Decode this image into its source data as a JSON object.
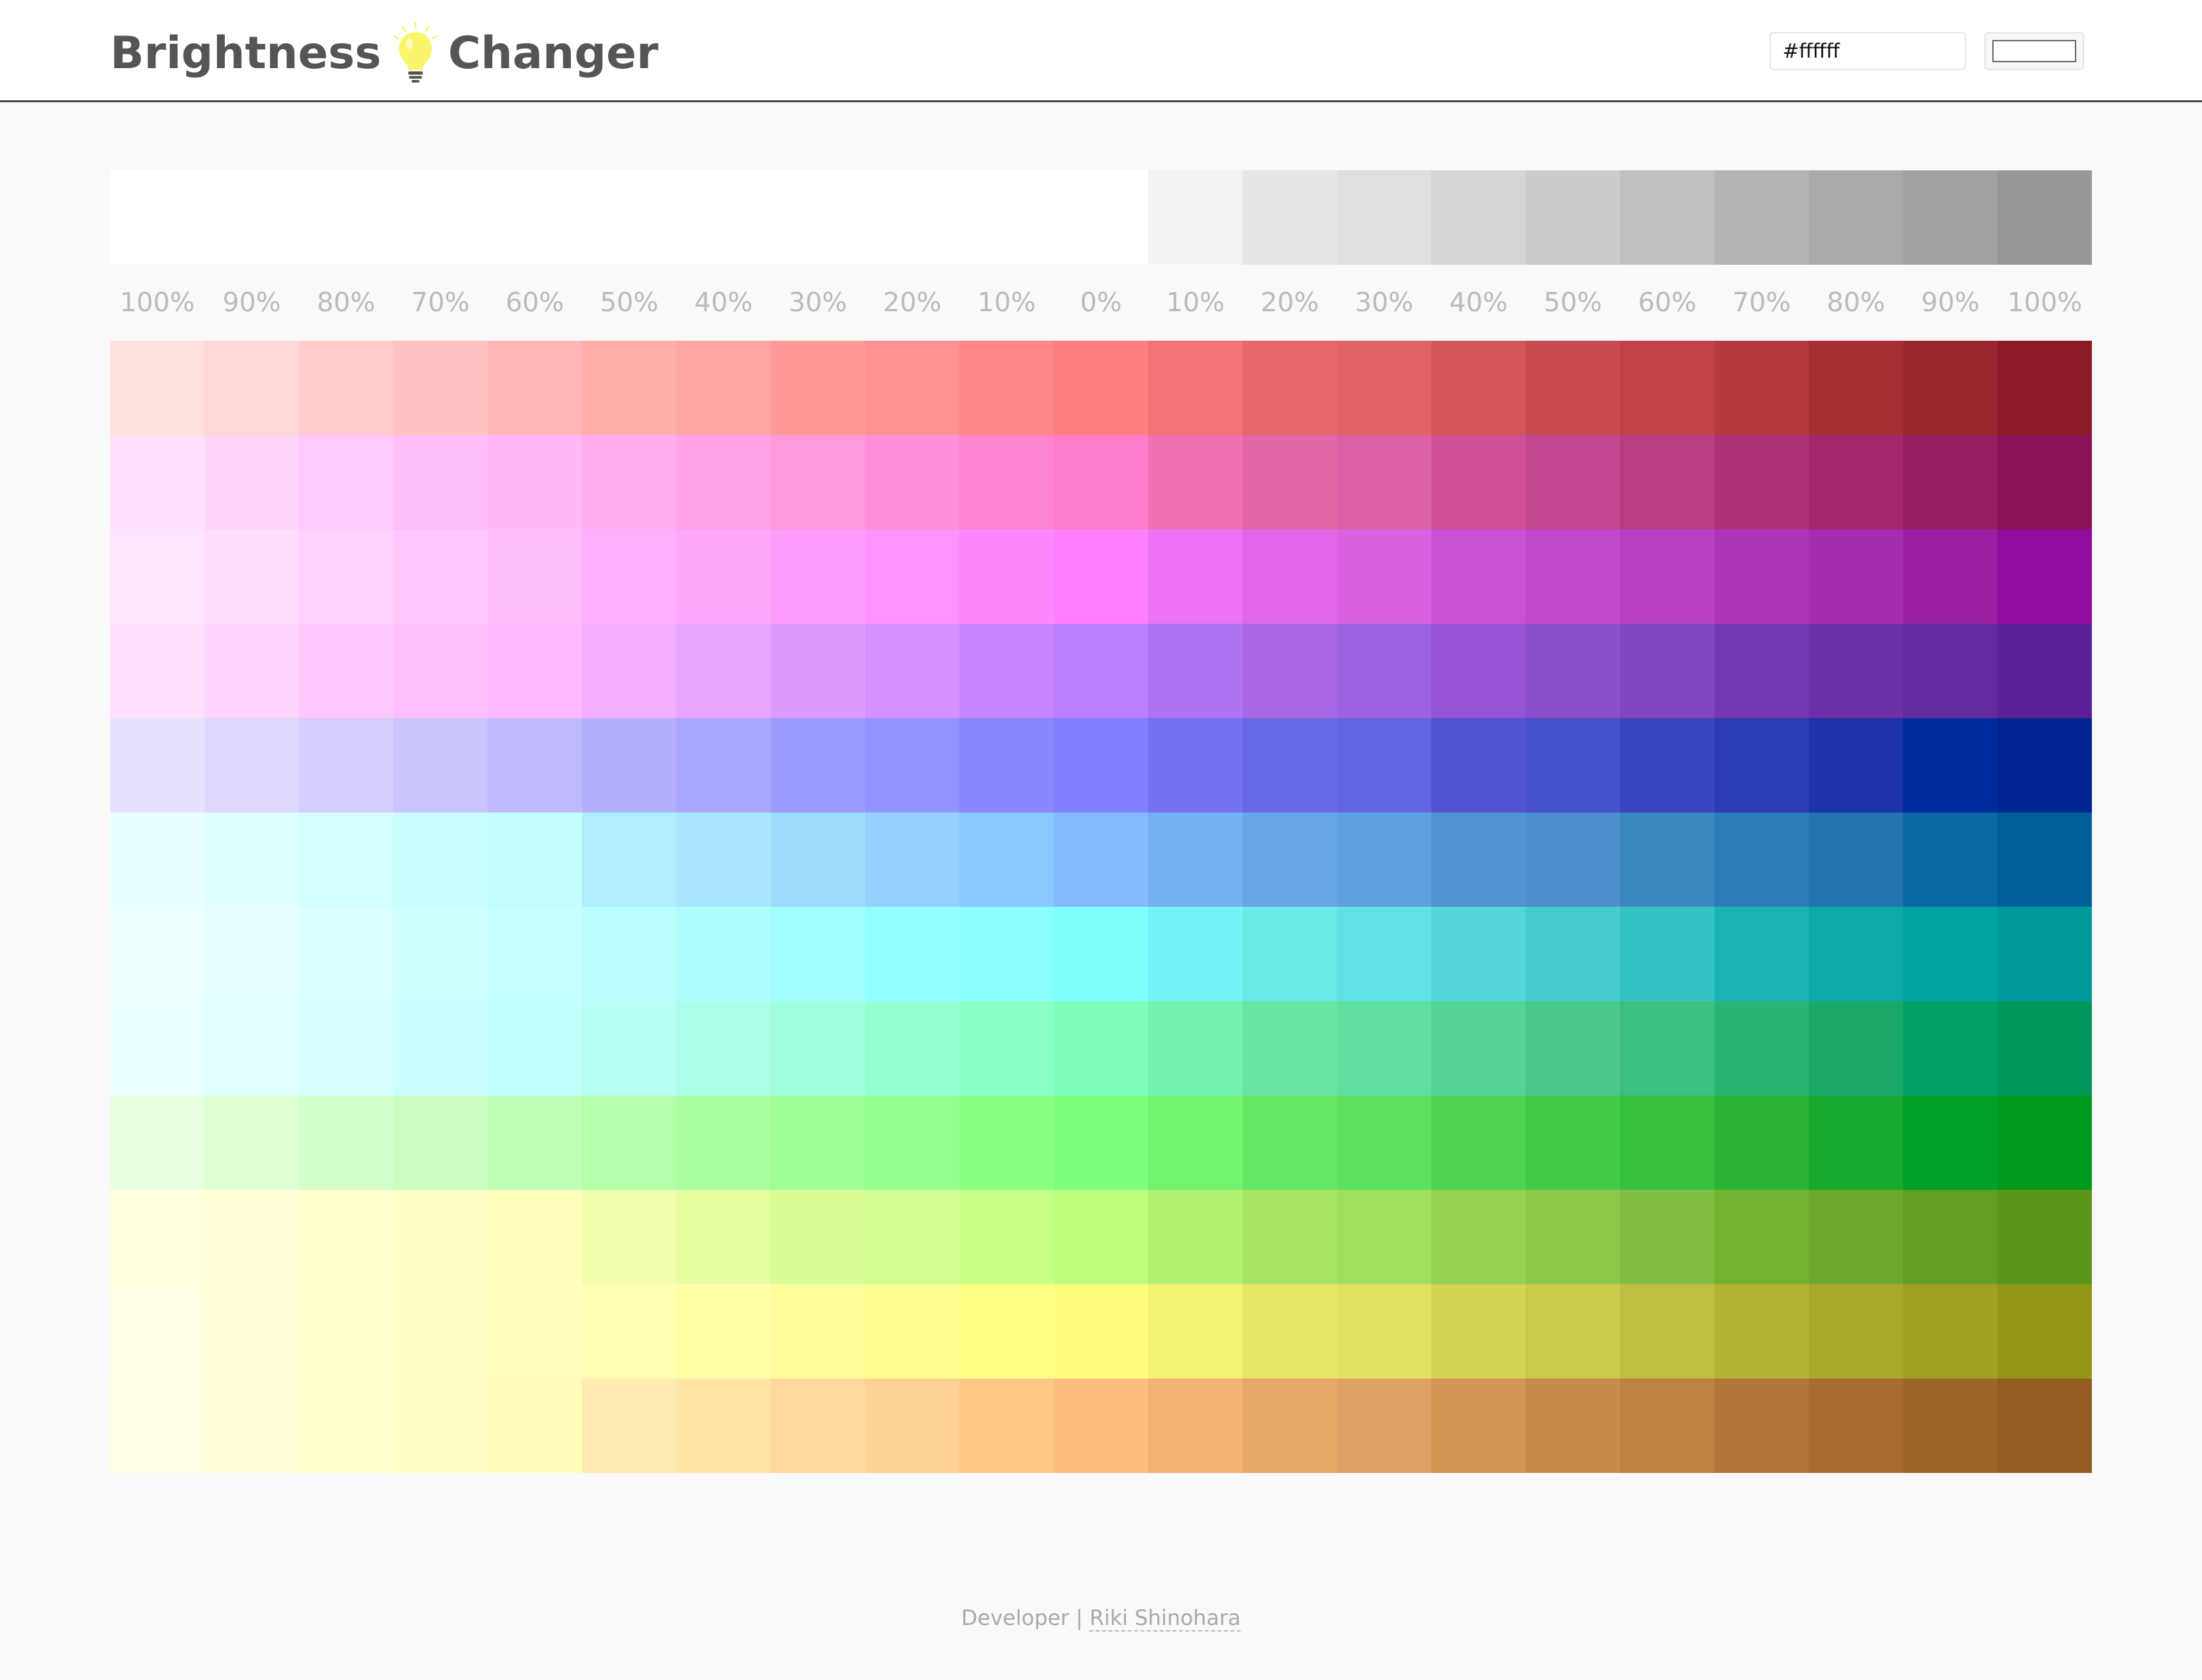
{
  "header": {
    "title_left": "Brightness",
    "title_right": "Changer",
    "hex_value": "#ffffff",
    "picker_color": "#ffffff"
  },
  "palette": {
    "labels": [
      "100%",
      "90%",
      "80%",
      "70%",
      "60%",
      "50%",
      "40%",
      "30%",
      "20%",
      "10%",
      "0%",
      "10%",
      "20%",
      "30%",
      "40%",
      "50%",
      "60%",
      "70%",
      "80%",
      "90%",
      "100%"
    ],
    "grayscale": [
      "#ffffff",
      "#ffffff",
      "#ffffff",
      "#ffffff",
      "#ffffff",
      "#ffffff",
      "#ffffff",
      "#ffffff",
      "#ffffff",
      "#ffffff",
      "#ffffff",
      "#f3f3f3",
      "#e7e7e7",
      "#dfdfdf",
      "#d4d4d4",
      "#cbcbcb",
      "#c0c0c0",
      "#b4b4b4",
      "#aaaaaa",
      "#a1a1a1",
      "#979797"
    ],
    "rows": [
      [
        "#ffe1dd",
        "#ffd7d6",
        "#ffcbcb",
        "#ffc2c0",
        "#ffb7b6",
        "#ffaeab",
        "#ffa5a5",
        "#ff9a96",
        "#ff9290",
        "#ff8787",
        "#ff7f7f",
        "#f27373",
        "#e66768",
        "#df6265",
        "#d35658",
        "#c94c52",
        "#bf4248",
        "#b53a3e",
        "#a62f36",
        "#9a2630",
        "#8e1b28"
      ],
      [
        "#ffe1fc",
        "#ffd5fc",
        "#ffc9fc",
        "#ffbefa",
        "#ffb7f8",
        "#ffaded",
        "#ffa3e7",
        "#ff99dc",
        "#ff8fd8",
        "#ff84cf",
        "#ff7ccb",
        "#f070b4",
        "#e366a8",
        "#dc60a6",
        "#d05097",
        "#c4488f",
        "#b93d83",
        "#ae3278",
        "#a4286e",
        "#981f62",
        "#8c1257"
      ],
      [
        "#ffe6fe",
        "#ffddfd",
        "#ffd0fc",
        "#ffc8fc",
        "#ffbcfc",
        "#ffb0fd",
        "#ffa7fd",
        "#ff9dfc",
        "#ff92fd",
        "#ff87fd",
        "#ff7ffe",
        "#ee72f5",
        "#e267e8",
        "#d962e0",
        "#cb51d4",
        "#c148cc",
        "#b840c3",
        "#ad34b6",
        "#a52bb1",
        "#9b1fa3",
        "#920b9f"
      ],
      [
        "#ffe1fd",
        "#ffd4fd",
        "#ffc8fd",
        "#ffbffd",
        "#ffb7fd",
        "#f4adff",
        "#e9a5ff",
        "#dd9aff",
        "#d390ff",
        "#c786ff",
        "#bd7dff",
        "#b173f1",
        "#a868e5",
        "#9e61df",
        "#9655d4",
        "#8c4fcc",
        "#8145c1",
        "#7536b3",
        "#6c30a8",
        "#632a9f",
        "#5c2097"
      ],
      [
        "#e8e1fe",
        "#dfd7fe",
        "#d6ceff",
        "#cac4ff",
        "#bfbaff",
        "#b2afff",
        "#a9a6ff",
        "#9c9cff",
        "#9193ff",
        "#8787ff",
        "#7f7fff",
        "#7373f2",
        "#6869e6",
        "#6067e0",
        "#5154d2",
        "#4750cb",
        "#3944c0",
        "#2c3bb4",
        "#1d33a8",
        "#002b9e",
        "#002691"
      ],
      [
        "#e8ffff",
        "#dfffff",
        "#d3ffff",
        "#cafffe",
        "#c1fefd",
        "#b1eefd",
        "#a9e6fe",
        "#9edcfd",
        "#94d1ff",
        "#8ac6ff",
        "#82bbfd",
        "#75b0f1",
        "#69a6e5",
        "#60a1df",
        "#5294d3",
        "#4b8fcc",
        "#3c87c0",
        "#2e7cb5",
        "#2374ac",
        "#0b68a2",
        "#005f99"
      ],
      [
        "#ecffff",
        "#e5ffff",
        "#dbffff",
        "#d0ffff",
        "#c6ffff",
        "#bcffff",
        "#afffff",
        "#a0ffff",
        "#94ffff",
        "#89ffff",
        "#80ffff",
        "#73f4f4",
        "#6be9e9",
        "#61e2e2",
        "#52d6d6",
        "#45cccc",
        "#35c2c2",
        "#1ab4b4",
        "#0daaaa",
        "#00a3a3",
        "#009898"
      ],
      [
        "#eaffff",
        "#e1ffff",
        "#d6ffff",
        "#cbffff",
        "#c1ffff",
        "#b8fff4",
        "#abffe8",
        "#9fffdc",
        "#93ffd2",
        "#89ffc7",
        "#7efcbb",
        "#73f2b0",
        "#69e6a5",
        "#5fdf9f",
        "#53d394",
        "#49ca8b",
        "#3dbf80",
        "#2ab373",
        "#1ba96a",
        "#00a064",
        "#009659"
      ],
      [
        "#e8ffe0",
        "#deffd5",
        "#d4ffca",
        "#cbffc1",
        "#c0ffb7",
        "#b3ffab",
        "#aaffa1",
        "#9dff95",
        "#93ff8e",
        "#88ff83",
        "#7dff7d",
        "#72f470",
        "#66e666",
        "#5de05e",
        "#4fd351",
        "#45ca48",
        "#35c03d",
        "#2ab435",
        "#1aaa2f",
        "#00a028",
        "#00991f"
      ],
      [
        "#ffffdf",
        "#fffed5",
        "#fffecd",
        "#fffec3",
        "#fffeba",
        "#f2feab",
        "#e6fea2",
        "#dafe97",
        "#d1fe8f",
        "#c7ff87",
        "#bdfe7e",
        "#b0f26f",
        "#a6e664",
        "#a0e05f",
        "#94d251",
        "#8ac94a",
        "#80bf41",
        "#73b332",
        "#6ba82b",
        "#619f25",
        "#59961b"
      ],
      [
        "#fffee3",
        "#fffed8",
        "#fffecf",
        "#fffec5",
        "#fffebc",
        "#fffeb1",
        "#fffea5",
        "#fffd9a",
        "#fffd8f",
        "#fffd85",
        "#fffd7e",
        "#f2f271",
        "#e7e767",
        "#dfe160",
        "#d2d452",
        "#c8ca49",
        "#bebf40",
        "#b2b334",
        "#a8a92c",
        "#9ea023",
        "#949617"
      ],
      [
        "#fffee2",
        "#fffed9",
        "#fffecd",
        "#fffec4",
        "#fffbbb",
        "#ffebb2",
        "#ffe5a6",
        "#ffd99b",
        "#ffd192",
        "#ffc887",
        "#ffbc7f",
        "#f3b172",
        "#e7a768",
        "#e0a063",
        "#d39455",
        "#c98b4b",
        "#bf8142",
        "#b27537",
        "#a76c2e",
        "#9e6528",
        "#945c21"
      ]
    ]
  },
  "footer": {
    "prefix": "Developer |",
    "developer_name": "Riki Shinohara"
  }
}
